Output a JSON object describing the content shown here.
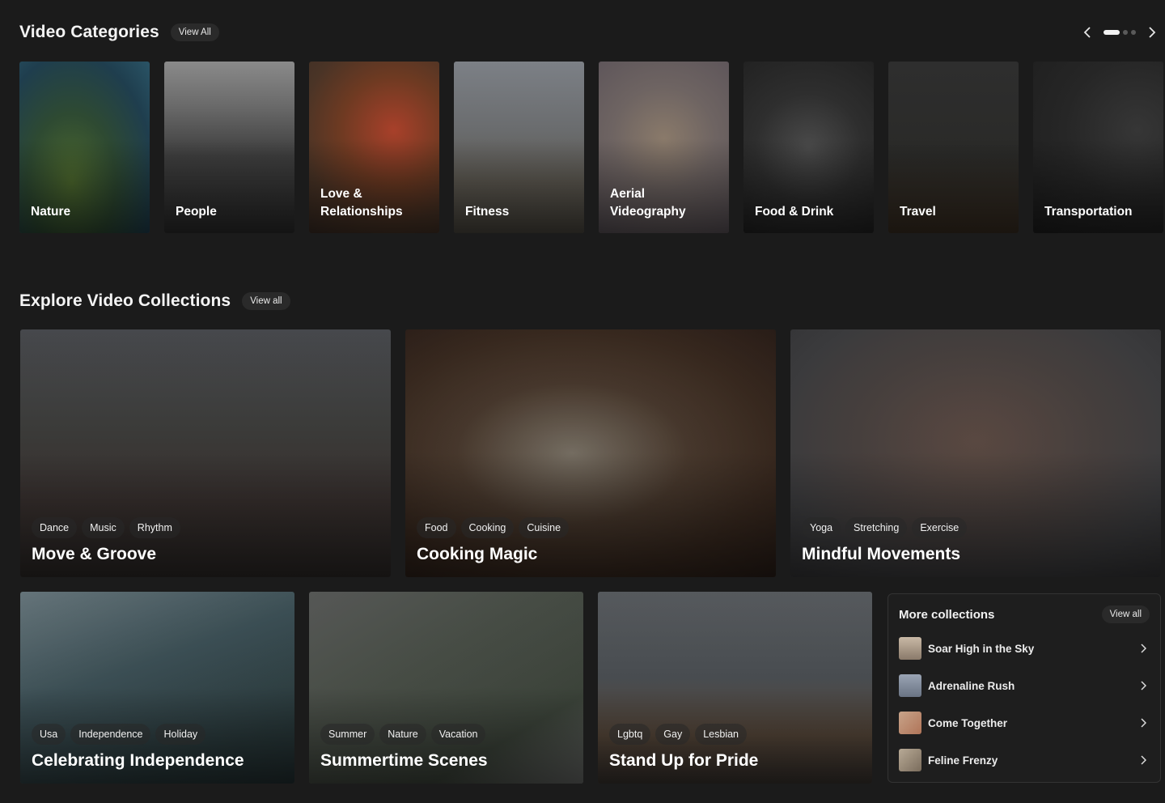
{
  "categories_section": {
    "title": "Video Categories",
    "view_all": "View All",
    "items": [
      {
        "label": "Nature"
      },
      {
        "label": "People"
      },
      {
        "label": "Love &\nRelationships"
      },
      {
        "label": "Fitness"
      },
      {
        "label": "Aerial\nVideography"
      },
      {
        "label": "Food & Drink"
      },
      {
        "label": "Travel"
      },
      {
        "label": "Transportation"
      }
    ],
    "prev_icon": "chevron-left-icon",
    "next_icon": "chevron-right-icon"
  },
  "collections_section": {
    "title": "Explore Video Collections",
    "view_all": "View all",
    "cards": [
      {
        "title": "Move & Groove",
        "tags": [
          "Dance",
          "Music",
          "Rhythm"
        ]
      },
      {
        "title": "Cooking Magic",
        "tags": [
          "Food",
          "Cooking",
          "Cuisine"
        ]
      },
      {
        "title": "Mindful Movements",
        "tags": [
          "Yoga",
          "Stretching",
          "Exercise"
        ]
      },
      {
        "title": "Celebrating Independence",
        "tags": [
          "Usa",
          "Independence",
          "Holiday"
        ]
      },
      {
        "title": "Summertime Scenes",
        "tags": [
          "Summer",
          "Nature",
          "Vacation"
        ]
      },
      {
        "title": "Stand Up for Pride",
        "tags": [
          "Lgbtq",
          "Gay",
          "Lesbian"
        ]
      }
    ]
  },
  "more_collections": {
    "title": "More collections",
    "view_all": "View all",
    "items": [
      {
        "label": "Soar High in the Sky"
      },
      {
        "label": "Adrenaline Rush"
      },
      {
        "label": "Come Together"
      },
      {
        "label": "Feline Frenzy"
      }
    ]
  }
}
